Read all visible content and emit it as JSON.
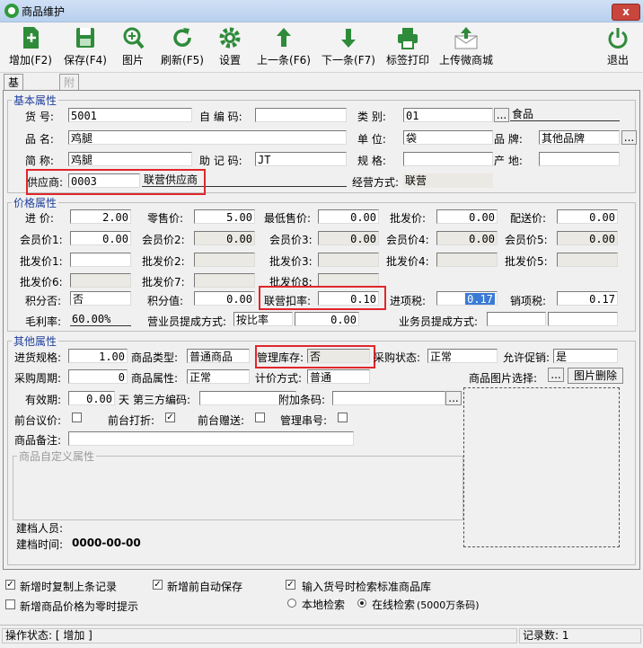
{
  "window": {
    "title": "商品维护",
    "close_label": "x"
  },
  "toolbar": {
    "add": "增加(F2)",
    "save": "保存(F4)",
    "picture": "图片",
    "refresh": "刷新(F5)",
    "settings": "设置",
    "prev": "上一条(F6)",
    "next": "下一条(F7)",
    "print_label": "标签打印",
    "upload": "上传微商城",
    "exit": "退出"
  },
  "tabs": {
    "basic": "基础信息",
    "extra": "附加信息"
  },
  "basic": {
    "legend": "基本属性",
    "code_label": "货  号:",
    "code": "5001",
    "selfcode_label": "自 编 码:",
    "selfcode": "",
    "category_label": "类  别:",
    "category": "01",
    "category_name": "食品",
    "name_label": "品  名:",
    "name": "鸡腿",
    "unit_label": "单  位:",
    "unit": "袋",
    "brand_label": "品  牌:",
    "brand": "其他品牌",
    "short_label": "简  称:",
    "short": "鸡腿",
    "mnemonic_label": "助 记 码:",
    "mnemonic": "JT",
    "spec_label": "规  格:",
    "spec": "",
    "origin_label": "产  地:",
    "origin": "",
    "supplier_label": "供应商:",
    "supplier_code": "0003",
    "supplier_name": "联营供应商",
    "mode_label": "经营方式:",
    "mode": "联营",
    "ellipsis": "..."
  },
  "price": {
    "legend": "价格属性",
    "purchase_label": "进  价:",
    "purchase": "2.00",
    "retail_label": "零售价:",
    "retail": "5.00",
    "min_label": "最低售价:",
    "min": "0.00",
    "wholesale_label": "批发价:",
    "wholesale": "0.00",
    "delivery_label": "配送价:",
    "delivery": "0.00",
    "m1_label": "会员价1:",
    "m1": "0.00",
    "m2_label": "会员价2:",
    "m2": "0.00",
    "m3_label": "会员价3:",
    "m3": "0.00",
    "m4_label": "会员价4:",
    "m4": "0.00",
    "m5_label": "会员价5:",
    "m5": "0.00",
    "w1_label": "批发价1:",
    "w2_label": "批发价2:",
    "w3_label": "批发价3:",
    "w4_label": "批发价4:",
    "w5_label": "批发价5:",
    "w6_label": "批发价6:",
    "w7_label": "批发价7:",
    "w8_label": "批发价8:",
    "points_flag_label": "积分否:",
    "points_flag": "否",
    "points_label": "积分值:",
    "points": "0.00",
    "deduct_label": "联营扣率:",
    "deduct": "0.10",
    "input_tax_label": "进项税:",
    "input_tax": "0.17",
    "output_tax_label": "销项税:",
    "output_tax": "0.17",
    "margin_label": "毛利率:",
    "margin": "60.00%",
    "commission_label": "营业员提成方式:",
    "commission_mode": "按比率",
    "commission_value": "0.00",
    "salesman_label": "业务员提成方式:"
  },
  "other": {
    "legend": "其他属性",
    "spec_label": "进货规格:",
    "spec": "1.00",
    "type_label": "商品类型:",
    "type": "普通商品",
    "stock_label": "管理库存:",
    "stock": "否",
    "purchase_status_label": "采购状态:",
    "purchase_status": "正常",
    "promo_label": "允许促销:",
    "promo": "是",
    "cycle_label": "采购周期:",
    "cycle": "0",
    "attr_label": "商品属性:",
    "attr": "正常",
    "pricing_label": "计价方式:",
    "pricing": "普通",
    "image_select_label": "商品图片选择:",
    "image_delete": "图片删除",
    "expiry_label": "有效期:",
    "expiry": "0.00",
    "expiry_unit": "天",
    "third_code_label": "第三方编码:",
    "third_code": "",
    "extra_barcode_label": "附加条码:",
    "extra_barcode": "",
    "haggle_label": "前台议价:",
    "discount_label": "前台打折:",
    "discount_check": "✓",
    "gift_label": "前台赠送:",
    "serial_label": "管理串号:",
    "remark_label": "商品备注:",
    "remark": "",
    "custom_legend": "商品自定义属性",
    "creator_label": "建档人员:",
    "creator": "",
    "created_label": "建档时间:",
    "created": "0000-00-00"
  },
  "options": {
    "copy_last": "新增时复制上条记录",
    "copy_last_check": "✓",
    "auto_save": "新增前自动保存",
    "auto_save_check": "✓",
    "search_std": "输入货号时检索标准商品库",
    "search_std_check": "✓",
    "zero_price_tip": "新增商品价格为零时提示",
    "local_search": "本地检索",
    "online_search": "在线检索",
    "online_note": "(5000万条码)"
  },
  "status": {
    "state_label": "操作状态:",
    "state": "[ 增加 ]",
    "count_label": "记录数:",
    "count": "1"
  },
  "colors": {
    "highlight": "#e0262b",
    "toolbar_icon": "#2e8b3a",
    "legend": "#1f3f9c"
  }
}
